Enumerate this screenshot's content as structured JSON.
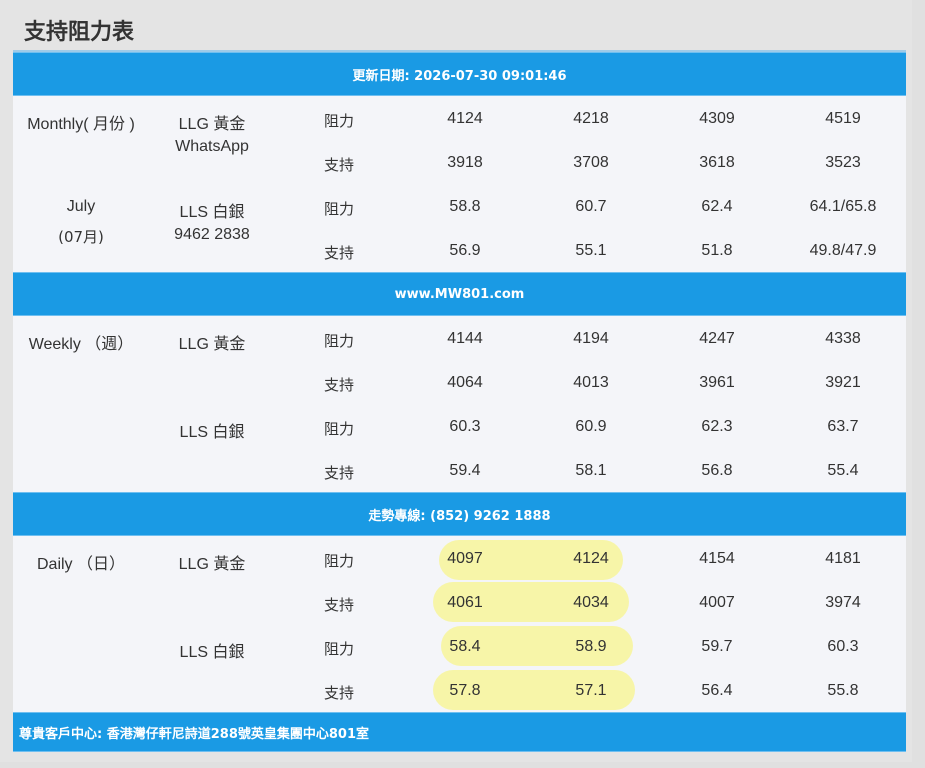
{
  "page_title": "支持阻力表",
  "banners": {
    "update": "更新日期: 2026-07-30 09:01:46",
    "site": "www.MW801.com",
    "hotline": "走勢專線: (852) 9262 1888",
    "footer": "尊貴客戶中心: 香港灣仔軒尼詩道288號英皇集團中心801室"
  },
  "monthly": {
    "period_label": "Monthly( 月份 )",
    "month_label": "July",
    "month_num": "(07月)",
    "llg": "LLG 黃金",
    "whatsapp": "WhatsApp",
    "lls": "LLS 白銀",
    "phone": "9462 2838",
    "rows": [
      {
        "type": "阻力",
        "v": [
          "4124",
          "4218",
          "4309",
          "4519"
        ]
      },
      {
        "type": "支持",
        "v": [
          "3918",
          "3708",
          "3618",
          "3523"
        ]
      },
      {
        "type": "阻力",
        "v": [
          "58.8",
          "60.7",
          "62.4",
          "64.1/65.8"
        ]
      },
      {
        "type": "支持",
        "v": [
          "56.9",
          "55.1",
          "51.8",
          "49.8/47.9"
        ]
      }
    ]
  },
  "weekly": {
    "period_label": "Weekly （週）",
    "llg": "LLG 黃金",
    "lls": "LLS 白銀",
    "rows": [
      {
        "type": "阻力",
        "v": [
          "4144",
          "4194",
          "4247",
          "4338"
        ]
      },
      {
        "type": "支持",
        "v": [
          "4064",
          "4013",
          "3961",
          "3921"
        ]
      },
      {
        "type": "阻力",
        "v": [
          "60.3",
          "60.9",
          "62.3",
          "63.7"
        ]
      },
      {
        "type": "支持",
        "v": [
          "59.4",
          "58.1",
          "56.8",
          "55.4"
        ]
      }
    ]
  },
  "daily": {
    "period_label": "Daily （日）",
    "llg": "LLG 黃金",
    "lls": "LLS 白銀",
    "rows": [
      {
        "type": "阻力",
        "v": [
          "4097",
          "4124",
          "4154",
          "4181"
        ]
      },
      {
        "type": "支持",
        "v": [
          "4061",
          "4034",
          "4007",
          "3974"
        ]
      },
      {
        "type": "阻力",
        "v": [
          "58.4",
          "58.9",
          "59.7",
          "60.3"
        ]
      },
      {
        "type": "支持",
        "v": [
          "57.8",
          "57.1",
          "56.4",
          "55.8"
        ]
      }
    ]
  },
  "colors": {
    "banner": "#1a9ae4",
    "highlight": "#f7f49a",
    "table_bg": "#f4f5f9"
  }
}
